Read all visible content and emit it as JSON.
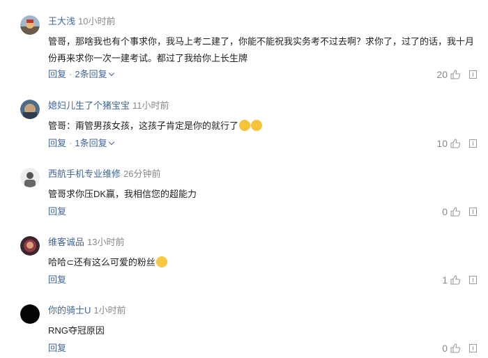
{
  "comments": [
    {
      "name": "王大浅",
      "time": "10小时前",
      "text": "管哥，那啥我也有个事求你，我马上考二建了，你能不能祝我实务考不过去啊？求你了，过了的话，我十月份再来求你一次一建考试。都过了我给你上长生牌",
      "reply": "回复",
      "sep": "·",
      "more": "2条回复",
      "likes": "20"
    },
    {
      "name": "媳妇儿生了个猪宝宝",
      "time": "11小时前",
      "text": "管哥：甭管男孩女孩，这孩子肯定是你的就行了",
      "reply": "回复",
      "sep": "·",
      "more": "1条回复",
      "likes": "10"
    },
    {
      "name": "西航手机专业维修",
      "time": "26分钟前",
      "text": "管哥求你压DK赢，我相信您的超能力",
      "reply": "回复",
      "likes": "0"
    },
    {
      "name": "维客诚品",
      "time": "13小时前",
      "text": "哈哈⊂还有这么可爱的粉丝",
      "reply": "回复",
      "likes": "1"
    },
    {
      "name": "你的骑士U",
      "time": "1小时前",
      "text": "RNG夺冠原因",
      "reply": "回复",
      "likes": "0"
    }
  ],
  "icons": {
    "like": "thumbs-up-outline",
    "report": "report-flag",
    "more_replies": "chevron-down"
  },
  "colors": {
    "link": "#406599",
    "meta": "#888888",
    "text": "#222222"
  }
}
